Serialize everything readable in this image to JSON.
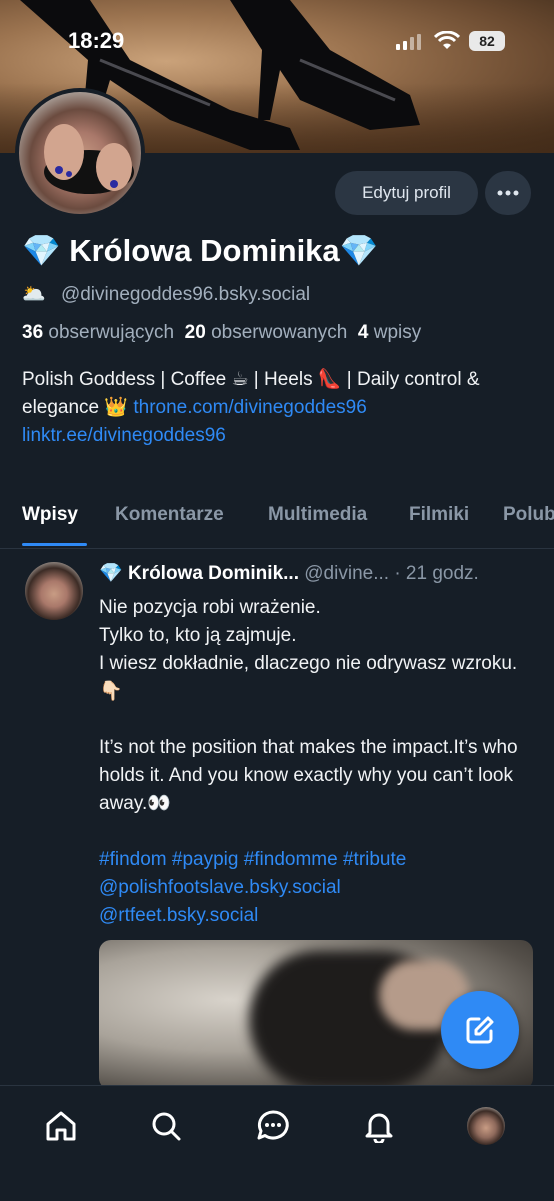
{
  "status_bar": {
    "time": "18:29",
    "battery": "82"
  },
  "profile": {
    "edit_label": "Edytuj profil",
    "name_emoji_left": "💎",
    "name": "Królowa Dominika",
    "name_emoji_right": "💎",
    "handle_emoji": "🌥️",
    "handle": "@divinegoddes96.bsky.social",
    "followers_count": "36",
    "followers_label": "obserwujących",
    "following_count": "20",
    "following_label": "obserwowanych",
    "posts_count": "4",
    "posts_label": "wpisy",
    "bio_text": "Polish Goddess | Coffee ☕ | Heels 👠 | Daily control & elegance 👑 ",
    "bio_link1": "throne.com/divinegoddes96",
    "bio_link2": "linktr.ee/divinegoddes96"
  },
  "tabs": [
    {
      "label": "Wpisy"
    },
    {
      "label": "Komentarze"
    },
    {
      "label": "Multimedia"
    },
    {
      "label": "Filmiki"
    },
    {
      "label": "Polub"
    }
  ],
  "post": {
    "name_emoji": "💎",
    "author": "Królowa Dominik...",
    "handle": "@divine...",
    "time": "· 21 godz.",
    "line1": "Nie pozycja robi wrażenie.",
    "line2": "Tylko to, kto ją zajmuje.",
    "line3": "I wiesz dokładnie, dlaczego nie odrywasz wzroku. 👇🏻",
    "line4": "It’s not the position that makes the impact.It’s who holds it. And you know exactly why you can’t look away.👀",
    "hashtags": "#findom #paypig #findomme #tribute",
    "mention1": "@polishfootslave.bsky.social",
    "mention2": "@rtfeet.bsky.social"
  },
  "icons": {
    "more": "more-horizontal-icon",
    "compose": "compose-icon",
    "home": "home-icon",
    "search": "search-icon",
    "chat": "chat-icon",
    "bell": "bell-icon"
  },
  "colors": {
    "accent": "#2f8af5",
    "background": "#161e27",
    "button": "#2b3643"
  }
}
